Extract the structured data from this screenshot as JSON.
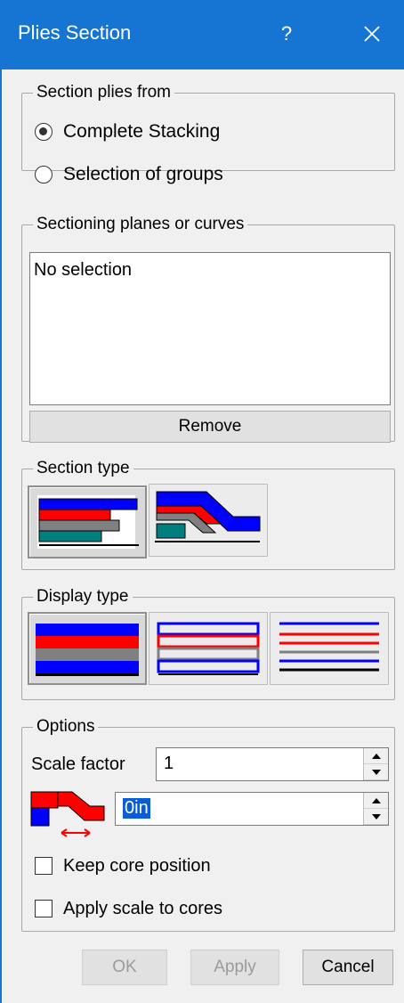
{
  "window": {
    "title": "Plies Section",
    "help": "?"
  },
  "section_from": {
    "legend": "Section plies from",
    "options": [
      {
        "label": "Complete Stacking",
        "checked": true
      },
      {
        "label": "Selection of groups",
        "checked": false
      }
    ]
  },
  "planes": {
    "legend": "Sectioning planes or curves",
    "list_text": "No selection",
    "remove_label": "Remove"
  },
  "section_type": {
    "legend": "Section type"
  },
  "display_type": {
    "legend": "Display type"
  },
  "options": {
    "legend": "Options",
    "scale_label": "Scale factor",
    "scale_value": "1",
    "offset_value": "0in",
    "keep_core": "Keep core position",
    "apply_scale": "Apply scale to cores"
  },
  "buttons": {
    "ok": "OK",
    "apply": "Apply",
    "cancel": "Cancel"
  },
  "colors": {
    "blue": "#0000ff",
    "red": "#ff0000",
    "gray": "#808080",
    "teal": "#007f7f"
  }
}
